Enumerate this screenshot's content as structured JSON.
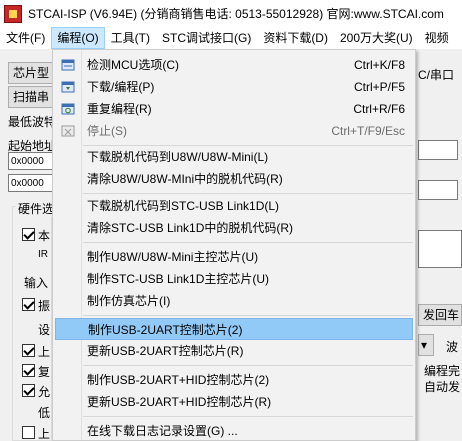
{
  "window": {
    "title": "STCAI-ISP (V6.94E) (分销商销售电话: 0513-55012928) 官网:www.STCAI.com"
  },
  "menubar": {
    "items": [
      "文件(F)",
      "编程(O)",
      "工具(T)",
      "STC调试接口(G)",
      "资料下载(D)",
      "200万大奖(U)",
      "视频"
    ]
  },
  "background": {
    "chip_type_label": "芯片型",
    "scan_button": "扫描串",
    "min_baud_label": "最低波特",
    "start_addr_label": "起始地址",
    "addr1": "0x0000",
    "addr2": "0x0000",
    "hw_options_label": "硬件选",
    "row_ben": "本",
    "row_ir": "IR",
    "input_label": "输入",
    "row_zhen": "振",
    "row_she": "设",
    "row_shang1": "上",
    "row_shang2": "上",
    "row_fu": "复",
    "row_yun": "允",
    "row_di": "低",
    "row_shang3": "上",
    "right_port": "C/串口",
    "right_send_button": "发回车",
    "right_bo": "波",
    "right_prog_done": "编程完",
    "right_auto_send": "自动发"
  },
  "dropdown": {
    "items": [
      {
        "label": "检测MCU选项(C)",
        "shortcut": "Ctrl+K/F8",
        "icon": "detect-mcu-icon"
      },
      {
        "label": "下载/编程(P)",
        "shortcut": "Ctrl+P/F5",
        "icon": "download-program-icon"
      },
      {
        "label": "重复编程(R)",
        "shortcut": "Ctrl+R/F6",
        "icon": "repeat-program-icon"
      },
      {
        "label": "停止(S)",
        "shortcut": "Ctrl+T/F9/Esc",
        "icon": "stop-icon"
      },
      {
        "label": "下载脱机代码到U8W/U8W-Mini(L)",
        "shortcut": ""
      },
      {
        "label": "清除U8W/U8W-MIni中的脱机代码(R)",
        "shortcut": ""
      },
      {
        "label": "下载脱机代码到STC-USB Link1D(L)",
        "shortcut": ""
      },
      {
        "label": "清除STC-USB Link1D中的脱机代码(R)",
        "shortcut": ""
      },
      {
        "label": "制作U8W/U8W-Mini主控芯片(U)",
        "shortcut": ""
      },
      {
        "label": "制作STC-USB Link1D主控芯片(U)",
        "shortcut": ""
      },
      {
        "label": "制作仿真芯片(I)",
        "shortcut": ""
      },
      {
        "label": "制作USB-2UART控制芯片(2)",
        "shortcut": ""
      },
      {
        "label": "更新USB-2UART控制芯片(R)",
        "shortcut": ""
      },
      {
        "label": "制作USB-2UART+HID控制芯片(2)",
        "shortcut": ""
      },
      {
        "label": "更新USB-2UART+HID控制芯片(R)",
        "shortcut": ""
      },
      {
        "label": "在线下载日志记录设置(G) ...",
        "shortcut": ""
      }
    ]
  }
}
